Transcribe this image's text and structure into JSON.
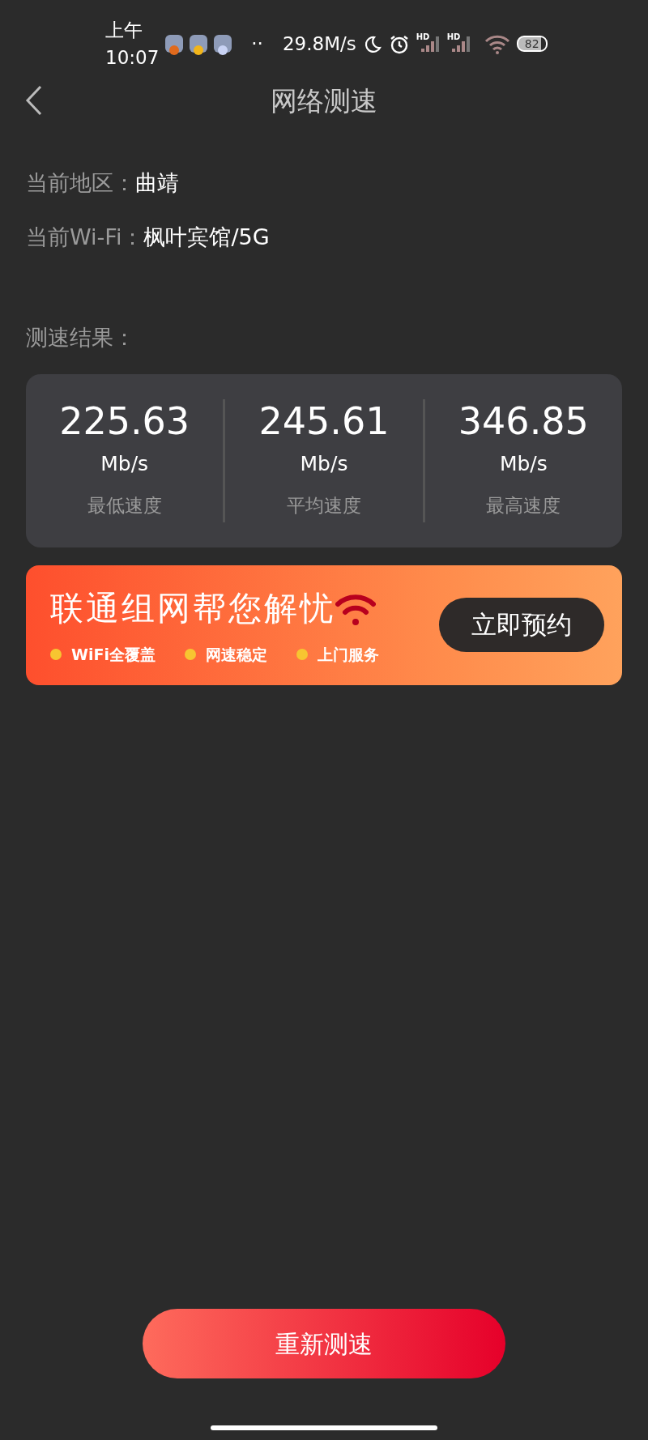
{
  "status_bar": {
    "time": "上午10:07",
    "dots": "··",
    "speed": "29.8M/s",
    "signals": [
      {
        "label": "HD"
      },
      {
        "label": "HD"
      }
    ],
    "battery": "82"
  },
  "header": {
    "title": "网络测速"
  },
  "info": [
    {
      "label": "当前地区：",
      "value": "曲靖"
    },
    {
      "label": "当前Wi-Fi：",
      "value": "枫叶宾馆/5G"
    }
  ],
  "results_label": "测速结果：",
  "results": [
    {
      "value": "225.63",
      "unit": "Mb/s",
      "label": "最低速度"
    },
    {
      "value": "245.61",
      "unit": "Mb/s",
      "label": "平均速度"
    },
    {
      "value": "346.85",
      "unit": "Mb/s",
      "label": "最高速度"
    }
  ],
  "banner": {
    "title": "联通组网帮您解忧",
    "features": [
      "WiFi全覆盖",
      "网速稳定",
      "上门服务"
    ],
    "button": "立即预约"
  },
  "retest_button": "重新测速"
}
